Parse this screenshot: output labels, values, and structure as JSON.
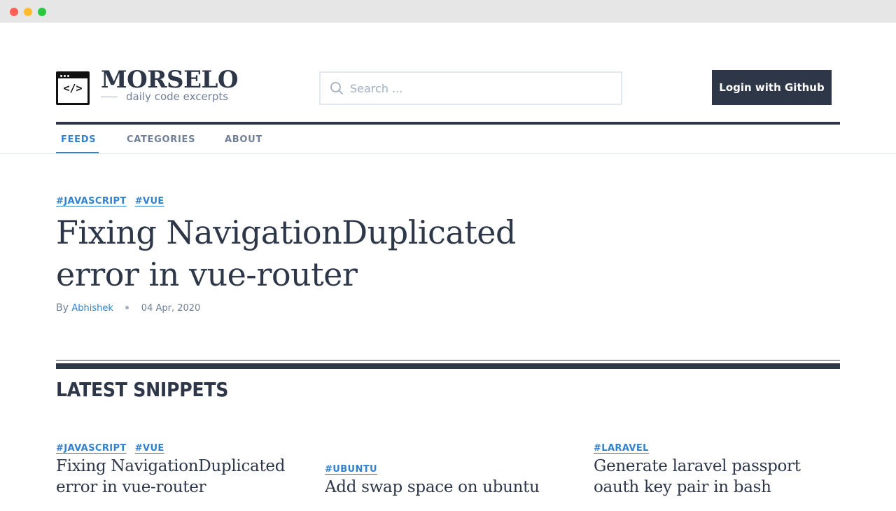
{
  "brand": {
    "name": "MORSELO",
    "tagline": "daily code excerpts",
    "logo_glyph": "</>"
  },
  "search": {
    "placeholder": "Search ..."
  },
  "header": {
    "login_label": "Login with Github"
  },
  "nav": {
    "items": [
      {
        "label": "FEEDS",
        "active": true
      },
      {
        "label": "CATEGORIES",
        "active": false
      },
      {
        "label": "ABOUT",
        "active": false
      }
    ]
  },
  "featured": {
    "tags": [
      "#JAVASCRIPT",
      "#VUE"
    ],
    "title": "Fixing NavigationDuplicated error in vue-router",
    "by_label": "By",
    "author": "Abhishek",
    "date": "04 Apr, 2020"
  },
  "latest": {
    "heading": "LATEST SNIPPETS",
    "cards": [
      {
        "tags": [
          "#JAVASCRIPT",
          "#VUE"
        ],
        "title": "Fixing NavigationDuplicated error in vue-router"
      },
      {
        "tags": [
          "#UBUNTU"
        ],
        "title": "Add swap space on ubuntu"
      },
      {
        "tags": [
          "#LARAVEL"
        ],
        "title": "Generate laravel passport oauth key pair in bash"
      }
    ]
  },
  "colors": {
    "primary": "#2d3748",
    "accent": "#3182ce",
    "muted": "#718096"
  }
}
